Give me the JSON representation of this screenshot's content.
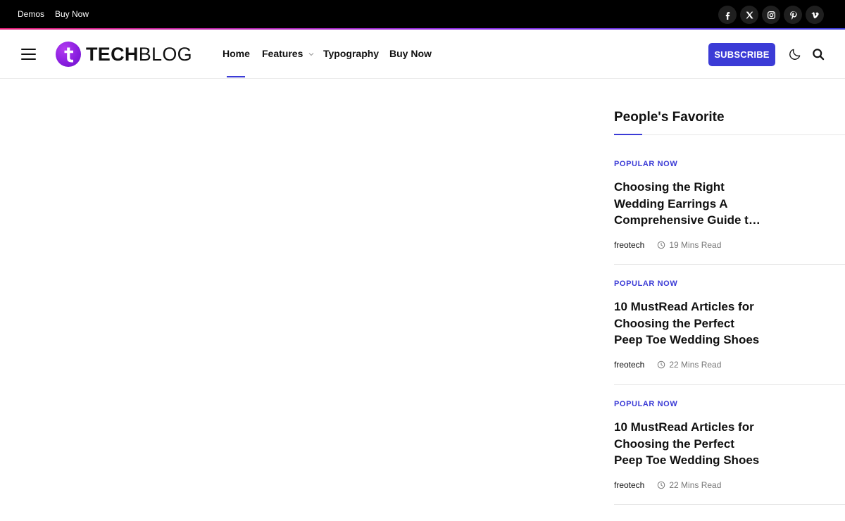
{
  "topbar": {
    "links": [
      "Demos",
      "Buy Now"
    ],
    "socials": [
      "facebook-icon",
      "x-icon",
      "instagram-icon",
      "pinterest-icon",
      "vimeo-icon"
    ]
  },
  "logo": {
    "bold": "TECH",
    "light": "BLOG"
  },
  "nav": {
    "items": [
      "Home",
      "Features",
      "Typography",
      "Buy Now"
    ],
    "active": "Home"
  },
  "header": {
    "subscribe_label": "SUBSCRIBE"
  },
  "sidebar": {
    "title": "People's Favorite",
    "posts": [
      {
        "category": "POPULAR NOW",
        "title": "Choosing the Right Wedding Earrings A Comprehensive Guide to Finding the Perfect Pair",
        "author": "freotech",
        "read_time": "19 Mins Read"
      },
      {
        "category": "POPULAR NOW",
        "title": "10 MustRead Articles for Choosing the Perfect Peep Toe Wedding Shoes",
        "author": "freotech",
        "read_time": "22 Mins Read"
      },
      {
        "category": "POPULAR NOW",
        "title": "10 MustRead Articles for Choosing the Perfect Peep Toe Wedding Shoes",
        "author": "freotech",
        "read_time": "22 Mins Read"
      }
    ]
  },
  "colors": {
    "accent": "#3b3bd6",
    "topbar": "#000000",
    "logo": "#8a1fe0"
  }
}
